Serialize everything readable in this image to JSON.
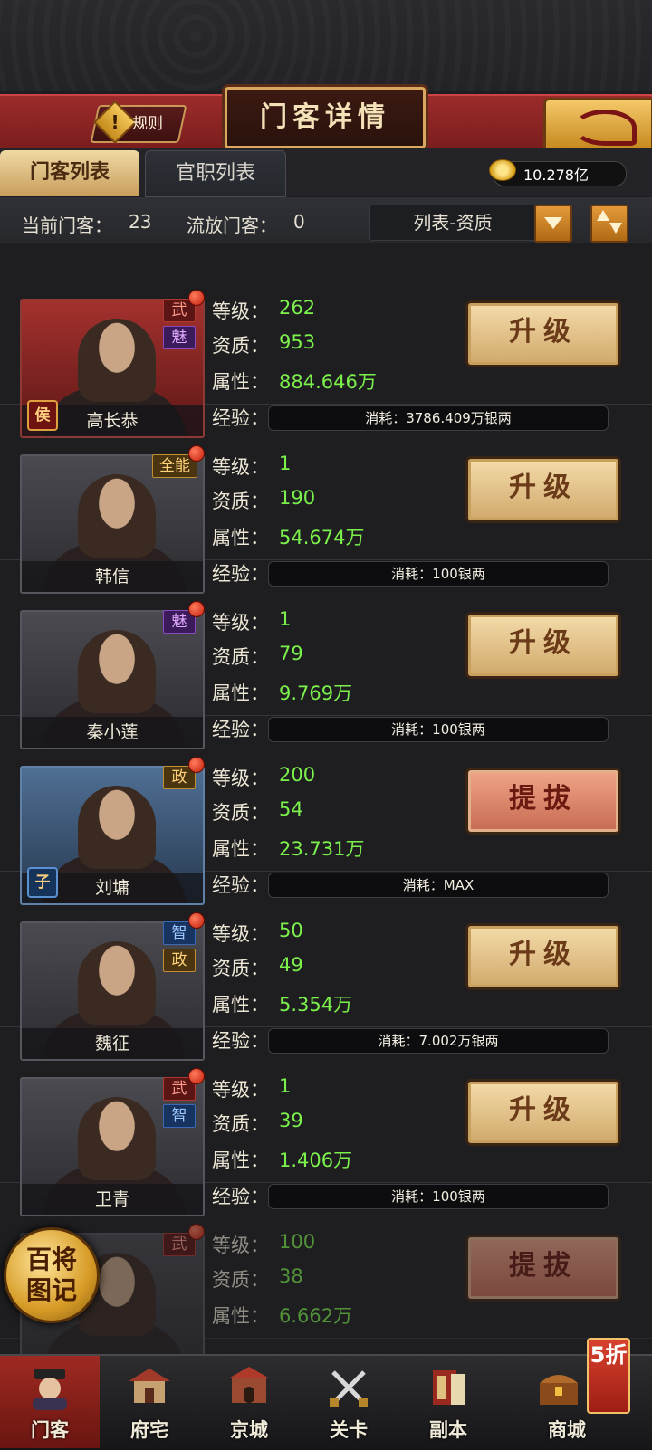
{
  "header": {
    "rules_label": "规则",
    "title": "门客详情",
    "back_icon": "dragon-back-icon"
  },
  "tabs": [
    {
      "label": "门客列表",
      "active": true
    },
    {
      "label": "官职列表",
      "active": false
    }
  ],
  "currency": {
    "icon": "coin-icon",
    "value": "10.278亿"
  },
  "summary": {
    "current_label": "当前门客：",
    "current_value": "23",
    "exiled_label": "流放门客：",
    "exiled_value": "0",
    "sort_label": "列表-资质"
  },
  "field_labels": {
    "level": "等级：",
    "quality": "资质：",
    "attr": "属性：",
    "exp": "经验："
  },
  "retainers": [
    {
      "name": "高长恭",
      "tags": [
        "武",
        "魅"
      ],
      "rank_badge": "侯",
      "level": "262",
      "quality": "953",
      "attr": "884.646万",
      "cost": "消耗：3786.409万银两",
      "action": "升级"
    },
    {
      "name": "韩信",
      "tags": [
        "全能"
      ],
      "level": "1",
      "quality": "190",
      "attr": "54.674万",
      "cost": "消耗：100银两",
      "action": "升级"
    },
    {
      "name": "秦小莲",
      "tags": [
        "魅"
      ],
      "level": "1",
      "quality": "79",
      "attr": "9.769万",
      "cost": "消耗：100银两",
      "action": "升级"
    },
    {
      "name": "刘墉",
      "tags": [
        "政"
      ],
      "rank_badge": "子",
      "level": "200",
      "quality": "54",
      "attr": "23.731万",
      "cost": "消耗：MAX",
      "action": "提拔"
    },
    {
      "name": "魏征",
      "tags": [
        "智",
        "政"
      ],
      "level": "50",
      "quality": "49",
      "attr": "5.354万",
      "cost": "消耗：7.002万银两",
      "action": "升级"
    },
    {
      "name": "卫青",
      "tags": [
        "武",
        "智"
      ],
      "level": "1",
      "quality": "39",
      "attr": "1.406万",
      "cost": "消耗：100银两",
      "action": "升级"
    },
    {
      "name": "",
      "tags": [
        "武"
      ],
      "level": "100",
      "quality": "38",
      "attr": "6.662万",
      "cost": "",
      "action": "提拔"
    }
  ],
  "floating_book": {
    "text": "百将图记"
  },
  "nav": [
    {
      "label": "门客",
      "icon": "official-portrait-icon",
      "active": true
    },
    {
      "label": "府宅",
      "icon": "mansion-icon",
      "active": false
    },
    {
      "label": "京城",
      "icon": "city-gate-icon",
      "active": false
    },
    {
      "label": "关卡",
      "icon": "crossed-swords-icon",
      "active": false
    },
    {
      "label": "副本",
      "icon": "book-icon",
      "active": false
    },
    {
      "label": "商城",
      "icon": "treasure-chest-icon",
      "active": false
    }
  ],
  "shop_badge": "5折"
}
